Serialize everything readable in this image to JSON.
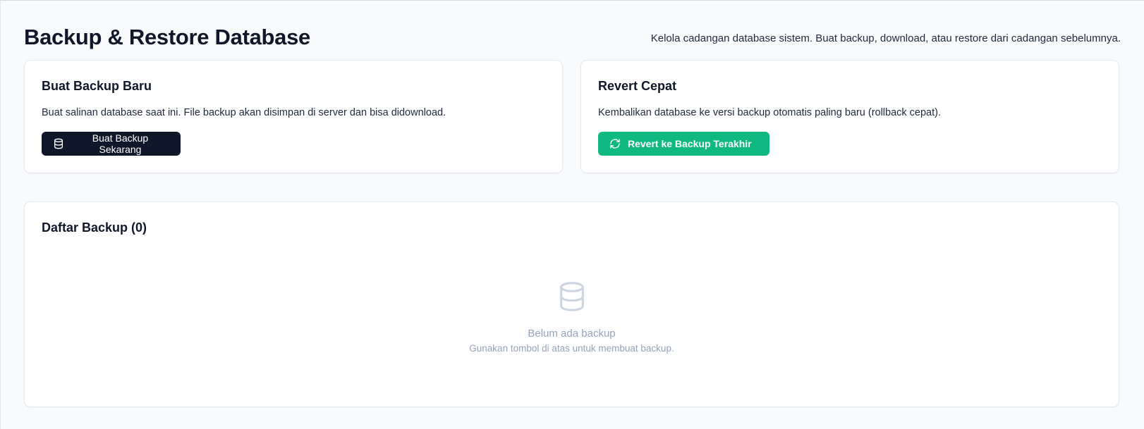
{
  "header": {
    "title": "Backup & Restore Database",
    "subtitle": "Kelola cadangan database sistem. Buat backup, download, atau restore dari cadangan sebelumnya."
  },
  "backup_card": {
    "title": "Buat Backup Baru",
    "description": "Buat salinan database saat ini. File backup akan disimpan di server dan bisa didownload.",
    "button_label": "Buat Backup Sekarang",
    "button_icon": "database-icon"
  },
  "revert_card": {
    "title": "Revert Cepat",
    "description": "Kembalikan database ke versi backup otomatis paling baru (rollback cepat).",
    "button_label": "Revert ke Backup Terakhir",
    "button_icon": "refresh-icon"
  },
  "list_card": {
    "title": "Daftar Backup (0)",
    "empty_icon": "database-icon",
    "empty_title": "Belum ada backup",
    "empty_subtitle": "Gunakan tombol di atas untuk membuat backup."
  },
  "colors": {
    "background": "#f8fafc",
    "primary_dark": "#0f172a",
    "success_green": "#10b981",
    "muted": "#94a3b8",
    "border": "#e2e8f0"
  }
}
